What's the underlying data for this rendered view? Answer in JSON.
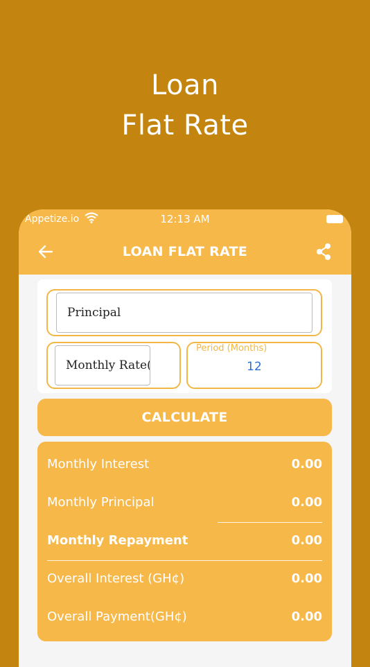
{
  "promo": {
    "line1": "Loan",
    "line2": "Flat Rate"
  },
  "status_bar": {
    "carrier": "Appetize.io",
    "time": "12:13 AM"
  },
  "app_bar": {
    "title": "LOAN FLAT RATE"
  },
  "form": {
    "principal_placeholder": "Principal",
    "monthly_rate_placeholder": "Monthly Rate(%",
    "period_label": "Period (Months)",
    "period_value": "12"
  },
  "calculate_label": "CALCULATE",
  "results": [
    {
      "label": "Monthly Interest",
      "value": "0.00"
    },
    {
      "label": "Monthly Principal",
      "value": "0.00"
    },
    {
      "label": "Monthly Repayment",
      "value": "0.00"
    },
    {
      "label": "Overall Interest (GH¢)",
      "value": "0.00"
    },
    {
      "label": "Overall Payment(GH¢)",
      "value": "0.00"
    }
  ],
  "colors": {
    "background": "#C3850F",
    "accent": "#F7B84A",
    "period_value": "#2B6FD6"
  },
  "icons": [
    "wifi-icon",
    "battery-icon",
    "back-arrow-icon",
    "share-icon"
  ]
}
